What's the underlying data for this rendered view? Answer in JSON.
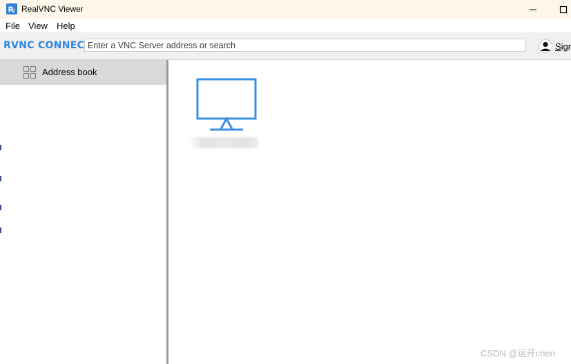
{
  "window": {
    "title": "RealVNC Viewer",
    "icon": "realvnc-app-icon",
    "controls": [
      "minimize-icon",
      "maximize-icon"
    ]
  },
  "menu": {
    "items": [
      "File",
      "View",
      "Help"
    ]
  },
  "toolbar": {
    "brand": "RVNC CONNECT",
    "search_placeholder": "Enter a VNC Server address or search",
    "search_value": "",
    "signin_label": "Sign"
  },
  "sidebar": {
    "items": [
      {
        "label": "Address book",
        "icon": "grid-icon",
        "selected": true
      }
    ]
  },
  "main": {
    "servers": [
      {
        "icon": "monitor-icon",
        "name_hidden": true
      }
    ]
  },
  "watermark": "CSDN @运开chen",
  "colors": {
    "accent": "#2f86e0",
    "monitor": "#3a8ee6",
    "selected_bg": "#d9d9d9",
    "titlebar_bg": "#fdf6ea",
    "toolbar_bg": "#f0f0f0"
  }
}
